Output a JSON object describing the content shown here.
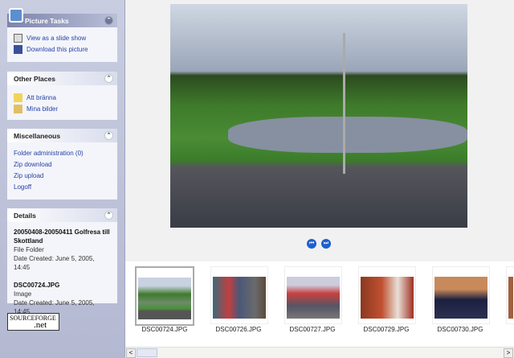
{
  "sidebar": {
    "picture_tasks": {
      "title": "Picture Tasks",
      "items": [
        {
          "label": "View as a slide show",
          "icon": "slideshow-icon"
        },
        {
          "label": "Download this picture",
          "icon": "floppy-disk-icon"
        }
      ]
    },
    "other_places": {
      "title": "Other Places",
      "items": [
        {
          "label": "Att bränna",
          "icon": "folder-icon"
        },
        {
          "label": "Mina bilder",
          "icon": "pictures-folder-icon"
        }
      ]
    },
    "misc": {
      "title": "Miscellaneous",
      "items": [
        {
          "label": "Folder administration (0)"
        },
        {
          "label": "Zip download"
        },
        {
          "label": "Zip upload"
        },
        {
          "label": "Logoff"
        }
      ]
    },
    "details": {
      "title": "Details",
      "folder": {
        "name": "20050408-20050411 Golfresa till Skottland",
        "type": "File Folder",
        "date": "Date Created: June 5, 2005, 14:45"
      },
      "file": {
        "name": "DSC00724.JPG",
        "type": "Image",
        "date": "Date Created: June 5, 2005, 14:45"
      }
    },
    "logo": {
      "line1": "SOURCEFORGE",
      "line2": ".net"
    }
  },
  "thumbnails": [
    {
      "name": "DSC00724.JPG",
      "selected": true
    },
    {
      "name": "DSC00726.JPG"
    },
    {
      "name": "DSC00727.JPG"
    },
    {
      "name": "DSC00729.JPG"
    },
    {
      "name": "DSC00730.JPG"
    }
  ],
  "nav": {
    "prev": "⏮",
    "next": "⏭"
  },
  "scrollbar": {
    "left": "<",
    "right": ">"
  }
}
